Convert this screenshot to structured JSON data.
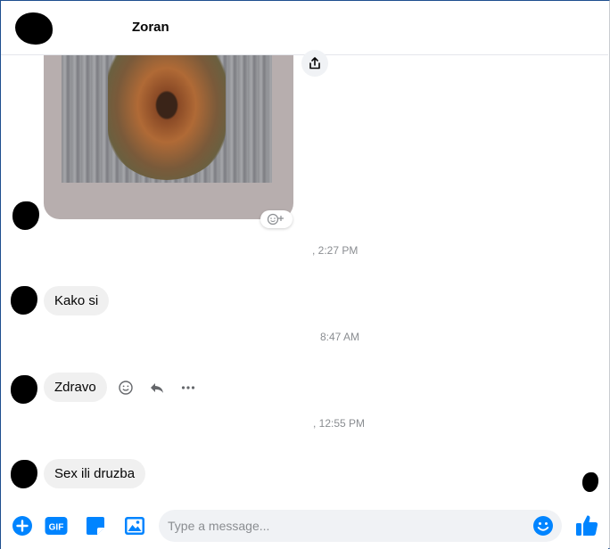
{
  "header": {
    "contact_name": "Zoran"
  },
  "messages": [
    {
      "text": "Kako si"
    },
    {
      "text": "Zdravo"
    },
    {
      "text": "Sex ili druzba"
    }
  ],
  "timestamps": [
    ", 2:27 PM",
    "8:47 AM",
    ", 12:55 PM"
  ],
  "composer": {
    "placeholder": "Type a message...",
    "gif_label": "GIF"
  },
  "colors": {
    "accent": "#0084ff",
    "bubble": "#f0f0f0"
  },
  "icons": [
    "share-icon",
    "add-reaction-icon",
    "emoji-icon",
    "reply-icon",
    "more-icon",
    "plus-icon",
    "gif-icon",
    "sticker-icon",
    "photo-icon",
    "smiley-icon",
    "thumbs-up-icon"
  ]
}
